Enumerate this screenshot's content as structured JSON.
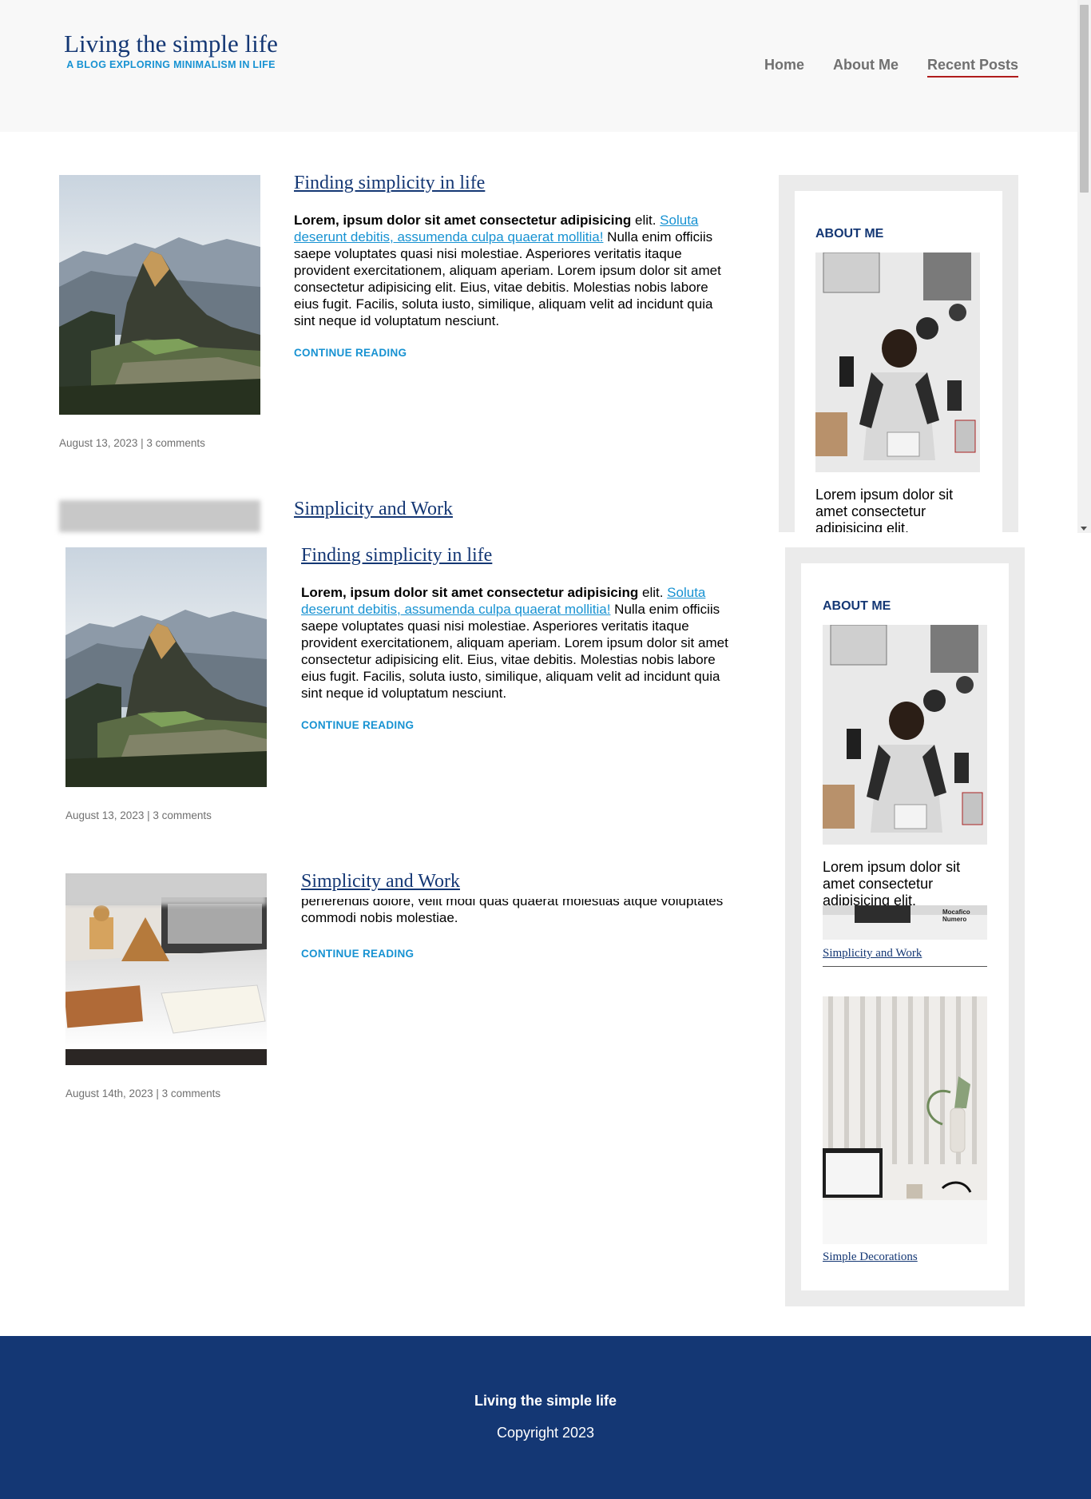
{
  "header": {
    "title": "Living the simple life",
    "subtitle": "A BLOG EXPLORING MINIMALISM IN LIFE",
    "nav": [
      {
        "label": "Home",
        "active": false
      },
      {
        "label": "About Me",
        "active": false
      },
      {
        "label": "Recent Posts",
        "active": true
      }
    ]
  },
  "posts": [
    {
      "title": "Finding simplicity in life",
      "excerpt_bold": "Lorem, ipsum dolor sit amet consectetur adipisicing",
      "excerpt_plain_1": " elit. ",
      "excerpt_link": "Soluta deserunt debitis, assumenda culpa quaerat mollitia!",
      "excerpt_rest": " Nulla enim officiis saepe voluptates quasi nisi molestiae. Asperiores veritatis itaque provident exercitationem, aliquam aperiam. Lorem ipsum dolor sit amet consectetur adipisicing elit. Eius, vitae debitis. Molestias nobis labore eius fugit. Facilis, soluta iusto, similique, aliquam velit ad incidunt quia sint neque id voluptatum nesciunt.",
      "continue": "CONTINUE READING",
      "date": "August 13, 2023",
      "separator": " | ",
      "comments": "3 comments",
      "image": "mountain-ruins-photo"
    },
    {
      "title": "Simplicity and Work",
      "excerpt_tail": "perferendis dolore, velit modi quas quaerat molestias atque voluptates commodi nobis molestiae.",
      "continue": "CONTINUE READING",
      "date": "August 14th, 2023",
      "separator": " | ",
      "comments": "3 comments",
      "image": "desk-workspace-photo"
    }
  ],
  "sidebar": {
    "heading": "ABOUT ME",
    "text": "Lorem ipsum dolor sit amet consectetur adipisicing elit.",
    "recent": [
      {
        "caption": "Simplicity and Work",
        "image": "mocafico-numero-photo",
        "image_text": "Mocafico Numero"
      },
      {
        "caption": "Simple Decorations",
        "image": "laptop-plant-photo"
      }
    ]
  },
  "footer": {
    "title": "Living the simple life",
    "copyright": "Copyright 2023"
  },
  "colors": {
    "brand_navy": "#143774",
    "accent_blue": "#1792d2",
    "nav_underline": "#b01c1c",
    "header_bg": "#f8f8f8",
    "sidebar_bg": "#ebebeb"
  }
}
